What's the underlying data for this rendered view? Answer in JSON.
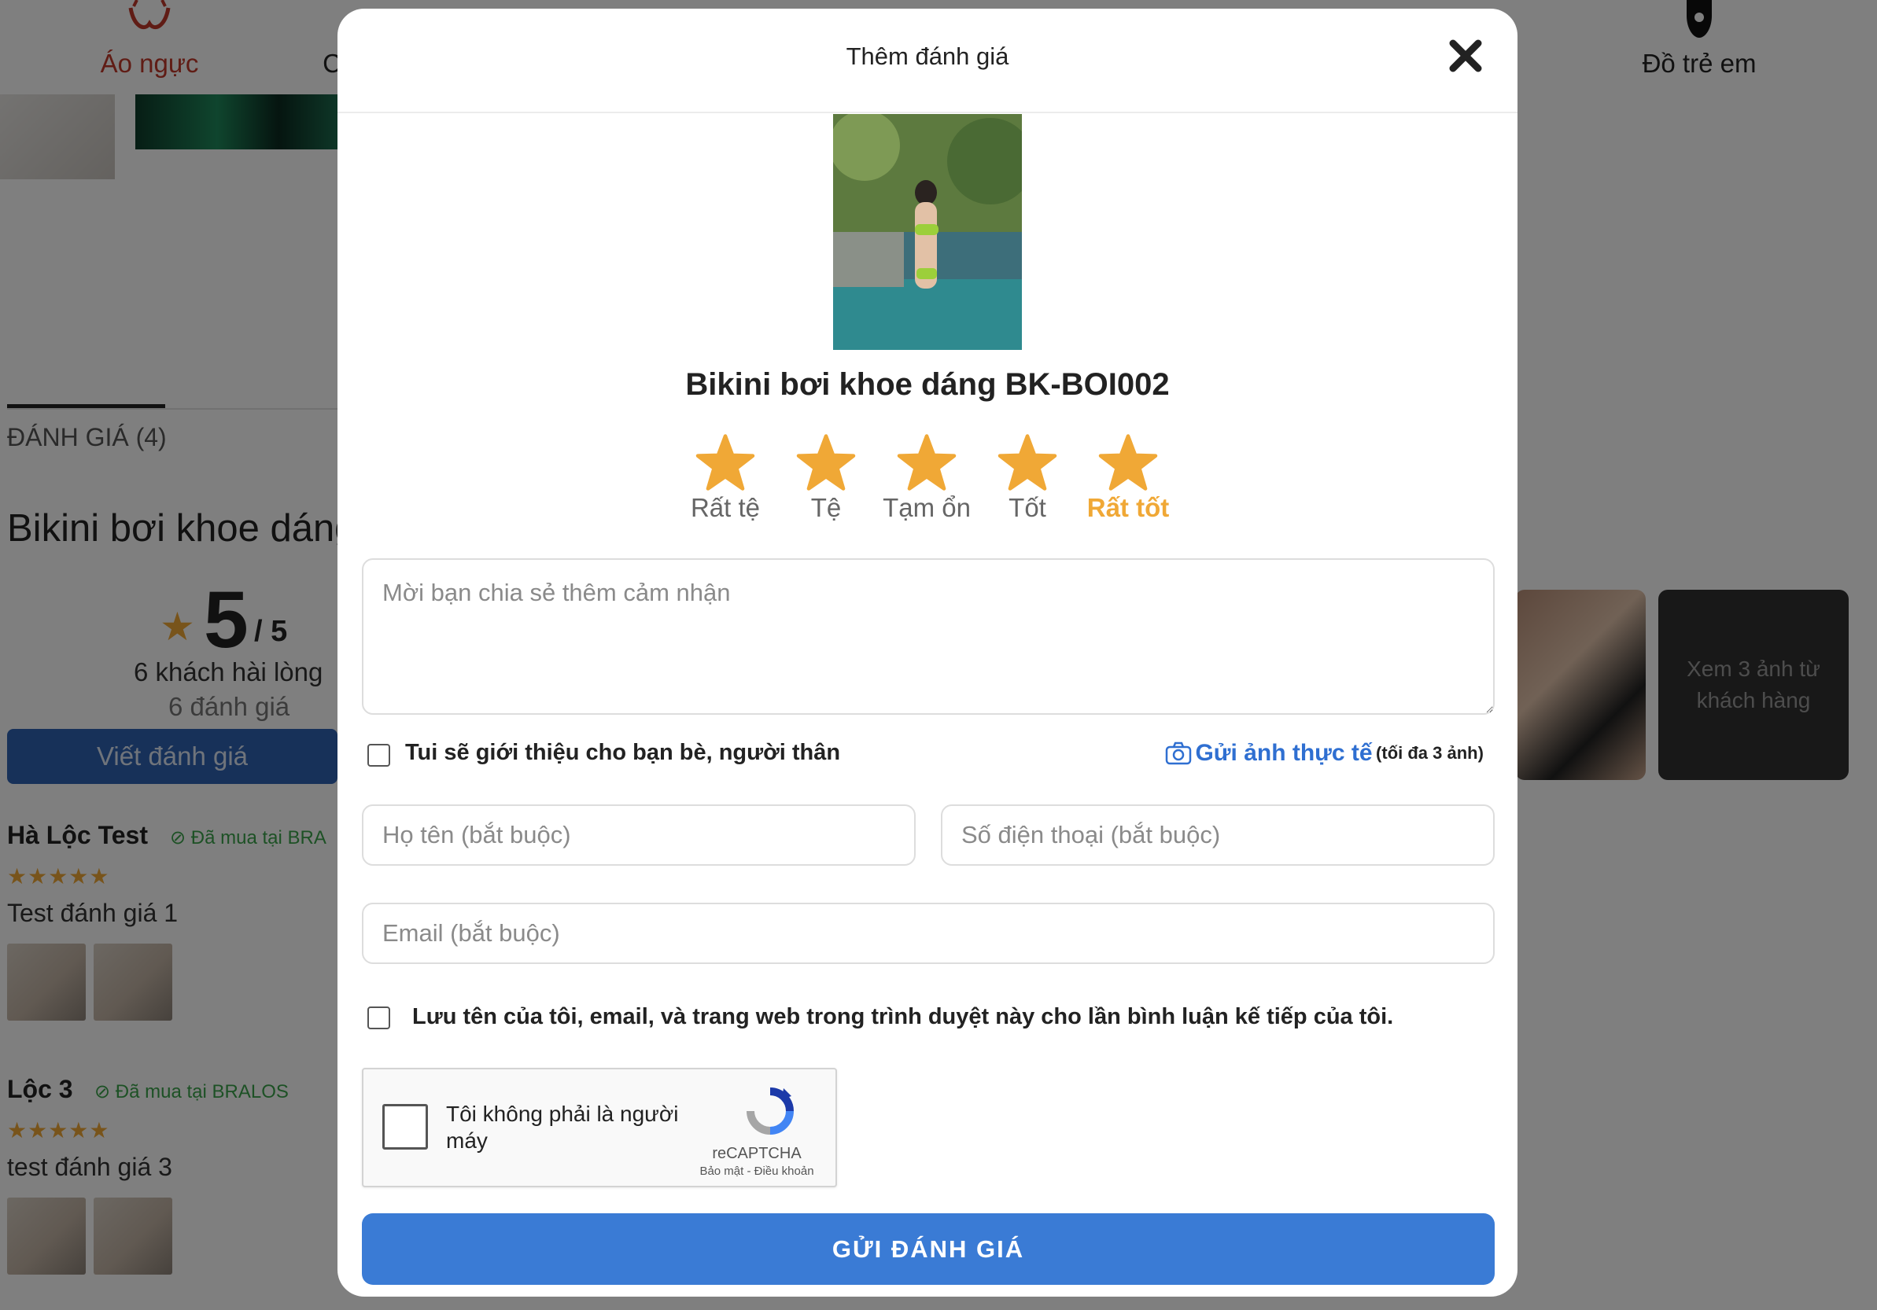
{
  "nav": {
    "items": [
      {
        "label": "Áo ngực",
        "icon": "bra-icon"
      },
      {
        "label": "C",
        "icon": "category-icon"
      },
      {
        "label": "Đồ trẻ em",
        "icon": "kids-icon"
      }
    ]
  },
  "reviews_section": {
    "tab_label": "ĐÁNH GIÁ (4)",
    "product_title": "Bikini bơi khoe dáng",
    "score": "5",
    "score_out_of": "/ 5",
    "satisfied_text": "6 khách hài lòng",
    "count_text": "6 đánh giá",
    "write_button": "Viết đánh giá",
    "more_photos": "Xem 3 ảnh từ khách hàng",
    "reviews": [
      {
        "name": "Hà Lộc Test",
        "badge": "Đã mua tại BRA",
        "stars": "★★★★★",
        "text": "Test đánh giá 1"
      },
      {
        "name": "Lộc 3",
        "badge": "Đã mua tại BRALOS",
        "stars": "★★★★★",
        "text": "test đánh giá 3"
      }
    ]
  },
  "modal": {
    "title": "Thêm đánh giá",
    "product_name": "Bikini bơi khoe dáng BK-BOI002",
    "rating_options": [
      "Rất tệ",
      "Tệ",
      "Tạm ổn",
      "Tốt",
      "Rất tốt"
    ],
    "selected_rating": 5,
    "star_color": "#f0a836",
    "comment_placeholder": "Mời bạn chia sẻ thêm cảm nhận",
    "recommend_label": "Tui sẽ giới thiệu cho bạn bè, người thân",
    "upload_label": "Gửi ảnh thực tế",
    "upload_note": "(tối đa 3 ảnh)",
    "name_placeholder": "Họ tên (bắt buộc)",
    "phone_placeholder": "Số điện thoại (bắt buộc)",
    "email_placeholder": "Email (bắt buộc)",
    "save_info_label": "Lưu tên của tôi, email, và trang web trong trình duyệt này cho lần bình luận kế tiếp của tôi.",
    "captcha": {
      "text": "Tôi không phải là người máy",
      "brand": "reCAPTCHA",
      "links": "Bảo mật - Điều khoản"
    },
    "submit_label": "GỬI ĐÁNH GIÁ",
    "accent_color": "#3a7bd5"
  }
}
